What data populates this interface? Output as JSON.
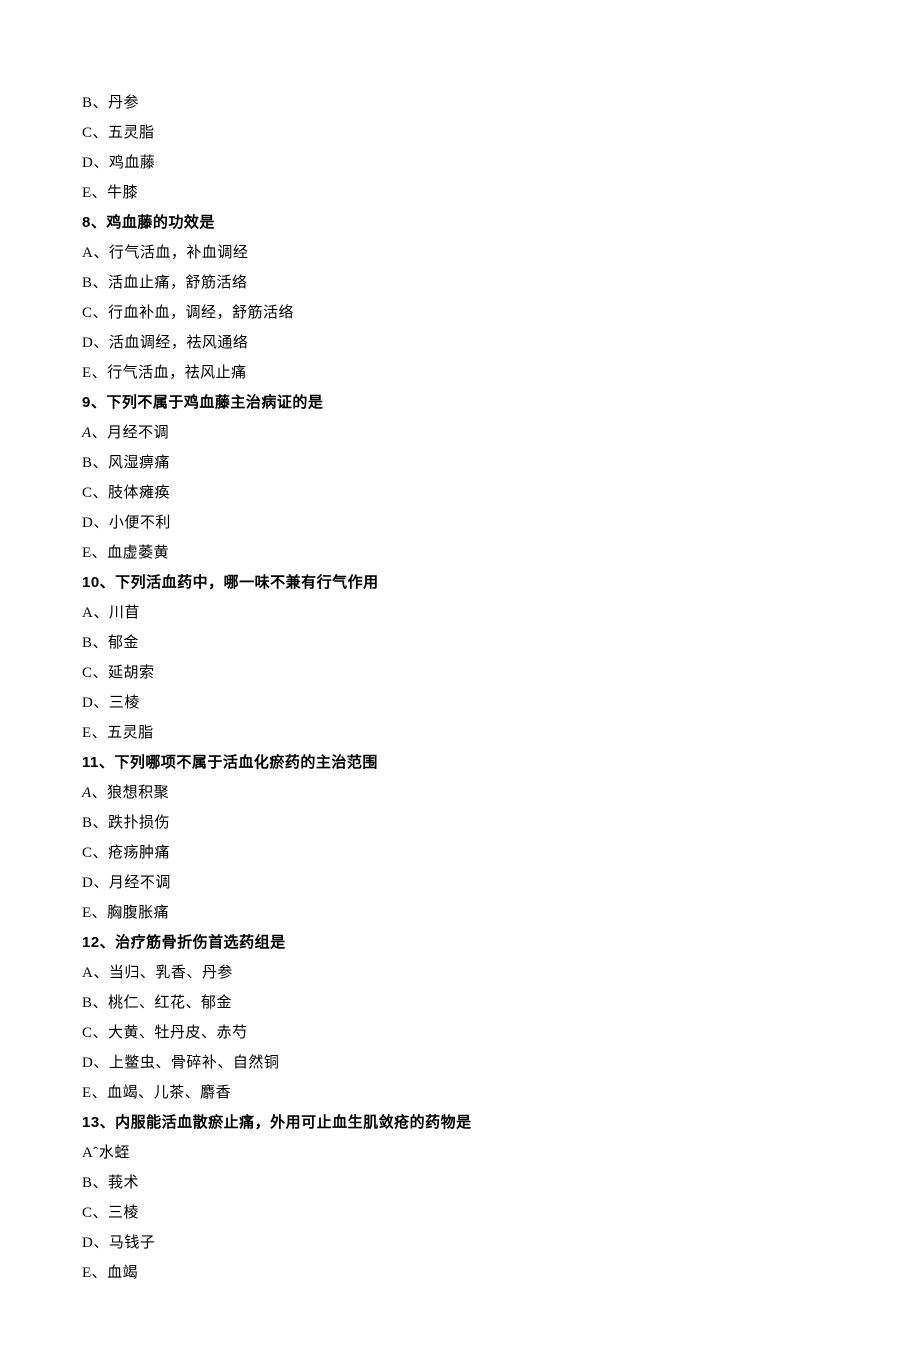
{
  "lines": {
    "opt7B": "B、丹参",
    "opt7C": "C、五灵脂",
    "opt7D": "D、鸡血藤",
    "opt7E": "E、牛膝",
    "q8": "8、鸡血藤的功效是",
    "opt8A": "A、行气活血，补血调经",
    "opt8B": "B、活血止痛，舒筋活络",
    "opt8C": "C、行血补血，调经，舒筋活络",
    "opt8D": "D、活血调经，祛风通络",
    "opt8E": "E、行气活血，祛风止痛",
    "q9": "9、下列不属于鸡血藤主治病证的是",
    "opt9A_letter": "A",
    "opt9A_text": "、月经不调",
    "opt9B": "B、风湿痹痛",
    "opt9C": "C、肢体瘫痪",
    "opt9D": "D、小便不利",
    "opt9E": "E、血虚萎黄",
    "q10": "10、下列活血药中，哪一味不兼有行气作用",
    "opt10A": "A、川苜",
    "opt10B": "B、郁金",
    "opt10C": "C、延胡索",
    "opt10D": "D、三棱",
    "opt10E": "E、五灵脂",
    "q11": "11、下列哪项不属于活血化瘀药的主治范围",
    "opt11A_letter": "A",
    "opt11A_text": "、狼想积聚",
    "opt11B": "B、跌扑损伤",
    "opt11C": "C、疮疡肿痛",
    "opt11D": "D、月经不调",
    "opt11E": "E、胸腹胀痛",
    "q12": "12、治疗筋骨折伤首选药组是",
    "opt12A": "A、当归、乳香、丹参",
    "opt12B": "B、桃仁、红花、郁金",
    "opt12C": "C、大黄、牡丹皮、赤芍",
    "opt12D": "D、上鳖虫、骨碎补、自然铜",
    "opt12E": "E、血竭、儿茶、麝香",
    "q13": "13、内服能活血散瘀止痛，外用可止血生肌敛疮的药物是",
    "opt13A": "Aˆ水蛭",
    "opt13B": "B、莪术",
    "opt13C": "C、三棱",
    "opt13D": "D、马钱子",
    "opt13E": "E、血竭"
  }
}
